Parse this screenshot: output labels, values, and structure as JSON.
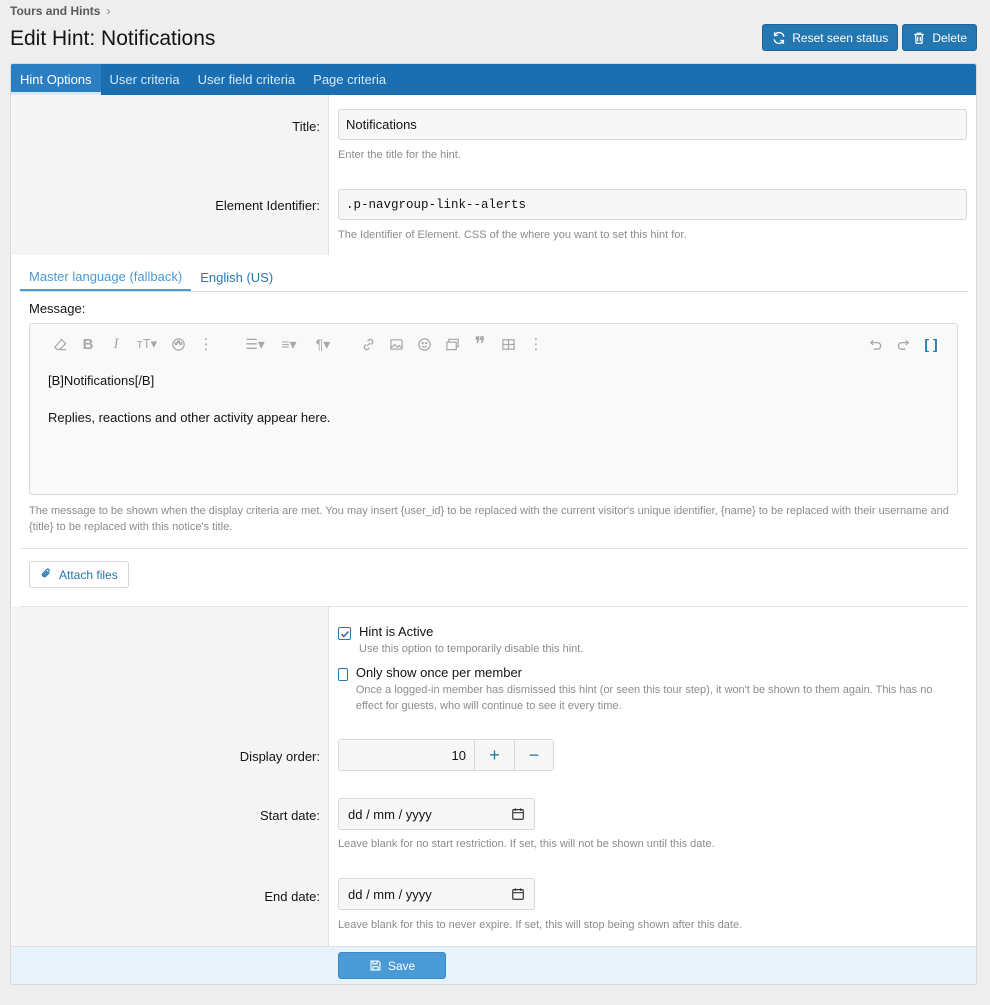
{
  "breadcrumb": {
    "item": "Tours and Hints"
  },
  "page": {
    "title": "Edit Hint: Notifications"
  },
  "actions": {
    "reset_label": "Reset seen status",
    "delete_label": "Delete"
  },
  "tabs": [
    {
      "label": "Hint Options"
    },
    {
      "label": "User criteria"
    },
    {
      "label": "User field criteria"
    },
    {
      "label": "Page criteria"
    }
  ],
  "form": {
    "title": {
      "label": "Title:",
      "value": "Notifications",
      "hint": "Enter the title for the hint."
    },
    "element": {
      "label": "Element Identifier:",
      "value": ".p-navgroup-link--alerts",
      "hint": "The Identifier of Element. CSS of the where you want to set this hint for."
    },
    "languages": [
      {
        "label": "Master language (fallback)"
      },
      {
        "label": "English (US)"
      }
    ],
    "message": {
      "label": "Message:",
      "line1": "[B]Notifications[/B]",
      "line2": "Replies, reactions and other activity appear here.",
      "hint": "The message to be shown when the display criteria are met. You may insert {user_id} to be replaced with the current visitor's unique identifier, {name} to be replaced with their username and {title} to be replaced with this notice's title."
    },
    "attach_label": "Attach files",
    "active": {
      "label": "Hint is Active",
      "hint": "Use this option to temporarily disable this hint.",
      "checked": true
    },
    "once": {
      "label": "Only show once per member",
      "hint": "Once a logged-in member has dismissed this hint (or seen this tour step), it won't be shown to them again. This has no effect for guests, who will continue to see it every time.",
      "checked": false
    },
    "display_order": {
      "label": "Display order:",
      "value": "10",
      "plus": "+",
      "minus": "−"
    },
    "start_date": {
      "label": "Start date:",
      "placeholder": "dd / mm / yyyy",
      "hint": "Leave blank for no start restriction. If set, this will not be shown until this date."
    },
    "end_date": {
      "label": "End date:",
      "placeholder": "dd / mm / yyyy",
      "hint": "Leave blank for this to never expire. If set, this will stop being shown after this date."
    },
    "save_label": "Save"
  },
  "colors": {
    "primary": "#2577b1",
    "tabbar": "#1a6fb3",
    "save": "#4a9ad6",
    "footer": "#e8f2fb"
  }
}
